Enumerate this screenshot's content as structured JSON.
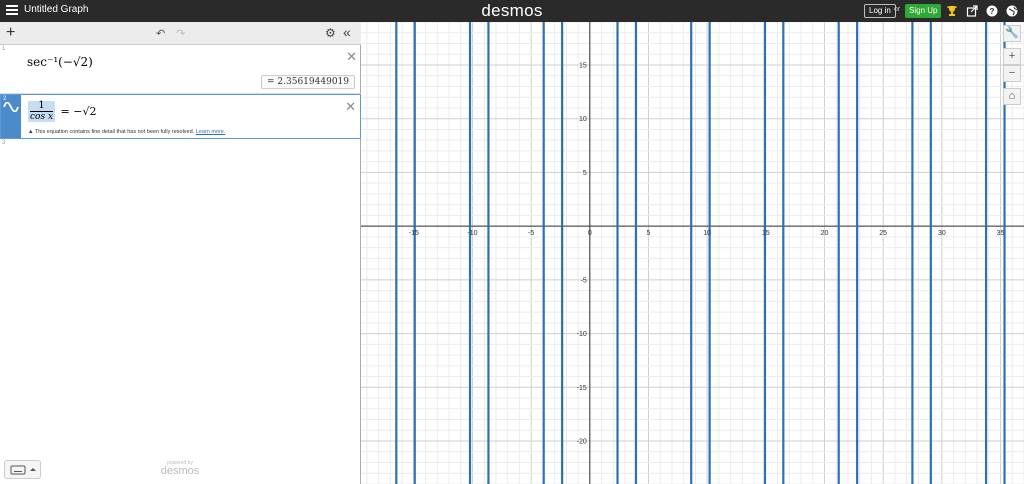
{
  "topbar": {
    "graph_title": "Untitled Graph",
    "brand": "desmos",
    "login_label": "Log in",
    "or_text": "or",
    "signup_label": "Sign Up",
    "icons": [
      "menu-icon",
      "trophy-icon",
      "share-icon",
      "help-icon",
      "globe-icon"
    ]
  },
  "toolbar": {
    "add_label": "+",
    "undo_label": "↶",
    "redo_label": "↷",
    "settings_label": "⚙",
    "collapse_label": "«"
  },
  "expressions": [
    {
      "number": "1",
      "latex_display": "sec⁻¹(−√2)",
      "result": "= 2.35619449019"
    },
    {
      "number": "2",
      "numerator": "1",
      "denominator": "cos x",
      "rhs": "= −√2",
      "warning": "This equation contains fine detail that has not been fully resolved.",
      "warning_link": "Learn more."
    },
    {
      "number": "3"
    }
  ],
  "footer": {
    "powered_by": "powered by",
    "powered_brand": "desmos"
  },
  "graph": {
    "accent_color": "#2d70b3",
    "x_range": [
      -19.5,
      37
    ],
    "y_range": [
      -24,
      19
    ],
    "x_ticks": [
      -15,
      -10,
      -5,
      0,
      5,
      10,
      15,
      20,
      25,
      30,
      35
    ],
    "y_ticks": [
      15,
      10,
      5,
      -5,
      -10,
      -15,
      -20
    ],
    "vertical_lines_x": [
      -16.49,
      -14.92,
      -10.21,
      -8.64,
      -3.93,
      -2.36,
      2.36,
      3.93,
      8.64,
      10.21,
      14.92,
      16.49,
      21.21,
      22.78,
      27.49,
      29.06,
      33.77,
      35.34
    ]
  },
  "graph_tools": [
    "wrench-icon",
    "zoom-in-icon",
    "zoom-out-icon",
    "home-icon"
  ]
}
